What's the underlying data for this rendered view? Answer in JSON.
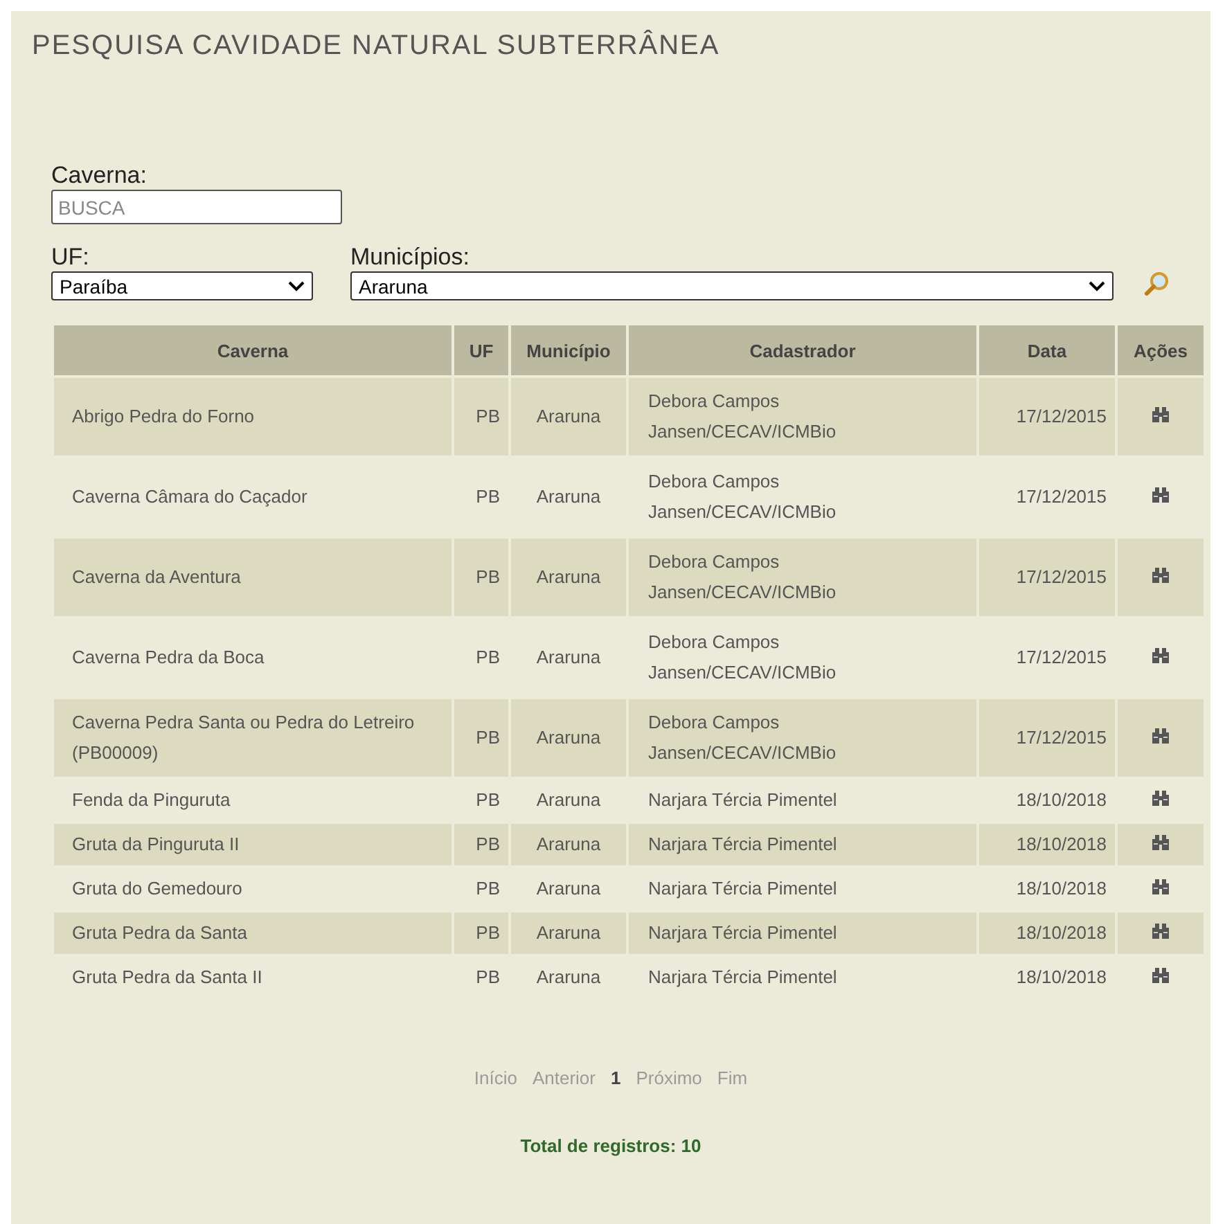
{
  "title": "PESQUISA CAVIDADE NATURAL SUBTERRÂNEA",
  "filters": {
    "caverna": {
      "label": "Caverna:",
      "placeholder": "BUSCA"
    },
    "uf": {
      "label": "UF:",
      "value": "Paraíba"
    },
    "municipios": {
      "label": "Municípios:",
      "value": "Araruna"
    }
  },
  "table": {
    "columns": [
      "Caverna",
      "UF",
      "Município",
      "Cadastrador",
      "Data",
      "Ações"
    ],
    "rows": [
      {
        "caverna": "Abrigo Pedra do Forno",
        "uf": "PB",
        "municipio": "Araruna",
        "cadastrador": [
          "Debora Campos",
          "Jansen/CECAV/ICMBio"
        ],
        "data": "17/12/2015"
      },
      {
        "caverna": "Caverna Câmara do Caçador",
        "uf": "PB",
        "municipio": "Araruna",
        "cadastrador": [
          "Debora Campos",
          "Jansen/CECAV/ICMBio"
        ],
        "data": "17/12/2015"
      },
      {
        "caverna": "Caverna da Aventura",
        "uf": "PB",
        "municipio": "Araruna",
        "cadastrador": [
          "Debora Campos",
          "Jansen/CECAV/ICMBio"
        ],
        "data": "17/12/2015"
      },
      {
        "caverna": "Caverna Pedra da Boca",
        "uf": "PB",
        "municipio": "Araruna",
        "cadastrador": [
          "Debora Campos",
          "Jansen/CECAV/ICMBio"
        ],
        "data": "17/12/2015"
      },
      {
        "caverna": "Caverna Pedra Santa ou Pedra do Letreiro (PB00009)",
        "uf": "PB",
        "municipio": "Araruna",
        "cadastrador": [
          "Debora Campos",
          "Jansen/CECAV/ICMBio"
        ],
        "data": "17/12/2015"
      },
      {
        "caverna": "Fenda da Pinguruta",
        "uf": "PB",
        "municipio": "Araruna",
        "cadastrador": [
          "Narjara Tércia Pimentel"
        ],
        "data": "18/10/2018"
      },
      {
        "caverna": "Gruta da Pinguruta II",
        "uf": "PB",
        "municipio": "Araruna",
        "cadastrador": [
          "Narjara Tércia Pimentel"
        ],
        "data": "18/10/2018"
      },
      {
        "caverna": "Gruta do Gemedouro",
        "uf": "PB",
        "municipio": "Araruna",
        "cadastrador": [
          "Narjara Tércia Pimentel"
        ],
        "data": "18/10/2018"
      },
      {
        "caverna": "Gruta Pedra da Santa",
        "uf": "PB",
        "municipio": "Araruna",
        "cadastrador": [
          "Narjara Tércia Pimentel"
        ],
        "data": "18/10/2018"
      },
      {
        "caverna": "Gruta Pedra da Santa II",
        "uf": "PB",
        "municipio": "Araruna",
        "cadastrador": [
          "Narjara Tércia Pimentel"
        ],
        "data": "18/10/2018"
      }
    ]
  },
  "pagination": [
    {
      "kind": "link",
      "label": "Início",
      "disabled": true
    },
    {
      "kind": "link",
      "label": "Anterior",
      "disabled": true
    },
    {
      "kind": "page",
      "label": "1",
      "selected": true
    },
    {
      "kind": "link",
      "label": "Próximo",
      "disabled": true
    },
    {
      "kind": "link",
      "label": "Fim",
      "disabled": true
    }
  ],
  "total": "Total de registros: 10"
}
